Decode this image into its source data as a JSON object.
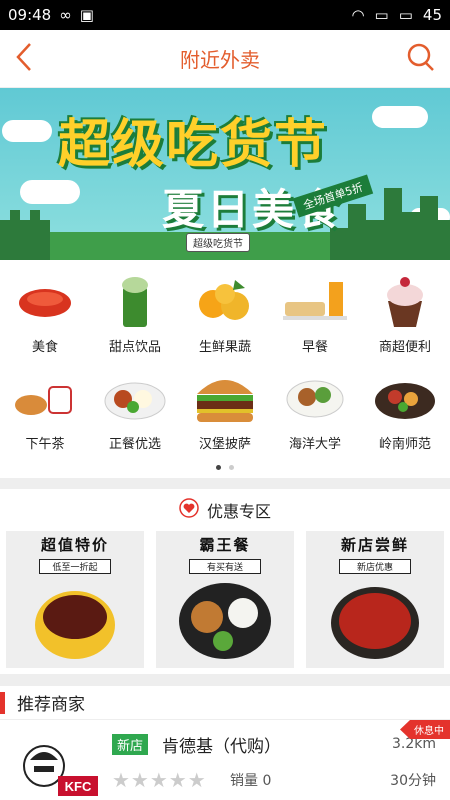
{
  "status": {
    "time": "09:48",
    "battery": "45"
  },
  "header": {
    "title": "附近外卖"
  },
  "banner": {
    "line1": "超级吃货节",
    "line2": "夏日美食",
    "tag": "全场首单5折",
    "bottom_tag": "超级吃货节"
  },
  "categories": [
    {
      "label": "美食"
    },
    {
      "label": "甜点饮品"
    },
    {
      "label": "生鲜果蔬"
    },
    {
      "label": "早餐"
    },
    {
      "label": "商超便利"
    },
    {
      "label": "下午茶"
    },
    {
      "label": "正餐优选"
    },
    {
      "label": "汉堡披萨"
    },
    {
      "label": "海洋大学"
    },
    {
      "label": "岭南师范"
    }
  ],
  "promo": {
    "title": "优惠专区",
    "cards": [
      {
        "title": "超值特价",
        "subtitle": "低至一折起"
      },
      {
        "title": "霸王餐",
        "subtitle": "有买有送"
      },
      {
        "title": "新店尝鲜",
        "subtitle": "新店优惠"
      }
    ]
  },
  "recommend": {
    "title": "推荐商家"
  },
  "shop": {
    "tag": "新店",
    "name": "肯德基（代购）",
    "distance": "3.2km",
    "sales": "销量 0",
    "time": "30分钟",
    "status": "休息中",
    "logo_text": "KFC"
  }
}
